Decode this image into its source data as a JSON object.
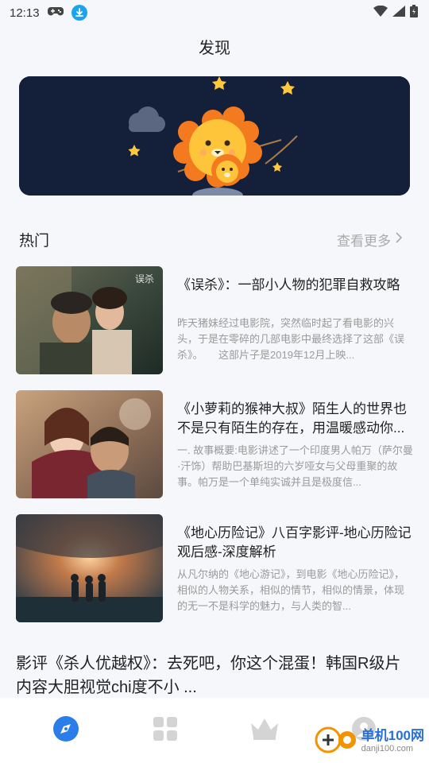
{
  "status_bar": {
    "time": "12:13"
  },
  "page": {
    "title": "发现"
  },
  "section": {
    "title": "热门",
    "see_more": "查看更多"
  },
  "articles": [
    {
      "title": "《误杀》：一部小人物的犯罪自救攻略",
      "desc": "昨天猪妹经过电影院，突然临时起了看电影的兴头，于是在零碎的几部电影中最终选择了这部《误杀》。　　这部片子是2019年12月上映..."
    },
    {
      "title": "《小萝莉的猴神大叔》陌生人的世界也不是只有陌生的存在，用温暖感动你...",
      "desc": "一. 故事概要:电影讲述了一个印度男人帕万（萨尔曼·汗饰）帮助巴基斯坦的六岁哑女与父母重聚的故事。帕万是一个单纯实诚并且是极度信..."
    },
    {
      "title": "《地心历险记》八百字影评-地心历险记观后感-深度解析",
      "desc": "从凡尔纳的《地心游记》，到电影《地心历险记》，相似的人物关系，相似的情节，相似的情景，体现的无一不是科学的魅力，与人类的智..."
    }
  ],
  "headline": "影评《杀人优越权》：去死吧，你这个混蛋！韩国R级片内容大胆视觉chi度不小 ...",
  "bottom_nav": {
    "items": [
      "compass-icon",
      "grid-icon",
      "crown-icon",
      "profile-icon"
    ],
    "active_color": "#2b7de9",
    "inactive_color": "#d4d4d4"
  },
  "watermark": {
    "main": "单机100网",
    "sub": "danji100.com"
  },
  "colors": {
    "banner_bg": "#141f3a",
    "accent": "#1aa3f0"
  }
}
